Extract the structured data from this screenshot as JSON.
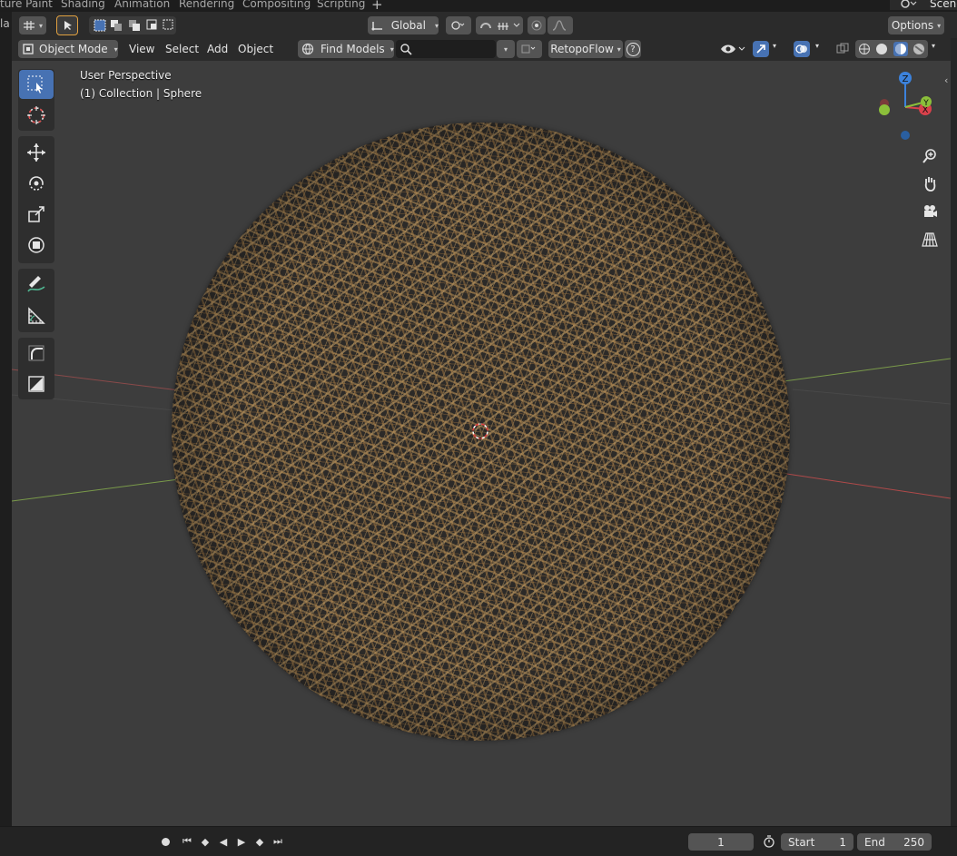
{
  "workspace_tabs": [
    "ture Paint",
    "Shading",
    "Animation",
    "Rendering",
    "Compositing",
    "Scripting"
  ],
  "add_workspace": "+",
  "scene_label": "Scene",
  "editor_partial": "la",
  "header": {
    "orientation": "Global",
    "options": "Options",
    "mode": "Object Mode",
    "menus": [
      "View",
      "Select",
      "Add",
      "Object"
    ],
    "find_models": "Find Models",
    "search_value": "",
    "retopoflow": "RetopoFlow",
    "help_icon": "?"
  },
  "viewport": {
    "perspective": "User Perspective",
    "collection": "(1) Collection | Sphere",
    "gizmo_z": "Z",
    "gizmo_x": "X",
    "gizmo_y": "Y"
  },
  "timeline": {
    "current_frame": "1",
    "start_label": "Start",
    "start_value": "1",
    "end_label": "End",
    "end_value": "250"
  },
  "colors": {
    "accent": "#4772b3",
    "axis_x": "#d9414b",
    "axis_y": "#8bbf3a",
    "axis_z": "#3c82dc",
    "material": "#b08a54"
  }
}
